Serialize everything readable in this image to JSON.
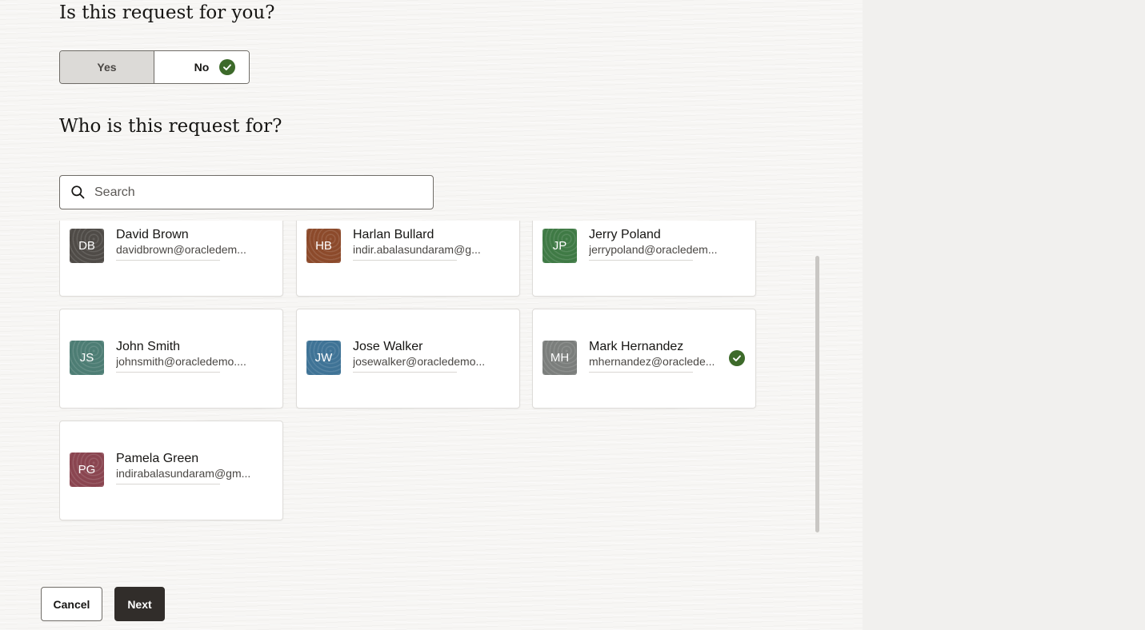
{
  "section1": {
    "title": "Is this request for you?",
    "yes_label": "Yes",
    "no_label": "No",
    "selected": "No"
  },
  "section2": {
    "title": "Who is this request for?"
  },
  "search": {
    "placeholder": "Search",
    "value": ""
  },
  "people": [
    {
      "initials": "DB",
      "name": "David Brown",
      "email": "davidbrown@oracledem...",
      "color": "#4f4b47",
      "selected": false
    },
    {
      "initials": "HB",
      "name": "Harlan Bullard",
      "email": "indir.abalasundaram@g...",
      "color": "#8c4a2b",
      "selected": false
    },
    {
      "initials": "JP",
      "name": "Jerry Poland",
      "email": "jerrypoland@oracledem...",
      "color": "#3f7a45",
      "selected": false
    },
    {
      "initials": "JS",
      "name": "John Smith",
      "email": "johnsmith@oracledemo....",
      "color": "#4d7d74",
      "selected": false
    },
    {
      "initials": "JW",
      "name": "Jose Walker",
      "email": "josewalker@oracledemo...",
      "color": "#3f7396",
      "selected": false
    },
    {
      "initials": "MH",
      "name": "Mark Hernandez",
      "email": "mhernandez@oraclede...",
      "color": "#7b7e7c",
      "selected": true
    },
    {
      "initials": "PG",
      "name": "Pamela Green",
      "email": "indirabalasundaram@gm...",
      "color": "#8a4550",
      "selected": false
    }
  ],
  "footer": {
    "cancel_label": "Cancel",
    "next_label": "Next"
  },
  "colors": {
    "accent_check": "#3d6a2a",
    "primary_button": "#312d2a"
  }
}
